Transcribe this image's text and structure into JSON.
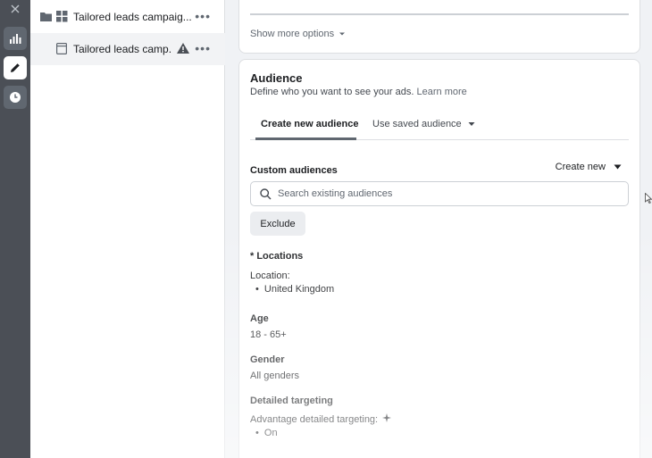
{
  "rail": {
    "icons": [
      "close-icon",
      "bar-chart-icon",
      "pencil-icon",
      "clock-icon"
    ]
  },
  "tree": {
    "campaign": {
      "label": "Tailored leads campaig...",
      "more": "•••"
    },
    "ad": {
      "label": "Tailored leads camp...",
      "more": "•••"
    }
  },
  "section_above": {
    "show_more_label": "Show more options"
  },
  "audience": {
    "title": "Audience",
    "description": "Define who you want to see your ads.",
    "learn_more": "Learn more",
    "tabs": [
      {
        "label": "Create new audience"
      },
      {
        "label": "Use saved audience"
      }
    ],
    "custom_audiences_label": "Custom audiences",
    "create_new_label": "Create new",
    "search_placeholder": "Search existing audiences",
    "exclude_label": "Exclude",
    "locations": {
      "heading": "* Locations",
      "sub": "Location:",
      "value": "United Kingdom"
    },
    "age": {
      "heading": "Age",
      "value": "18 - 65+"
    },
    "gender": {
      "heading": "Gender",
      "value": "All genders"
    },
    "detailed": {
      "heading": "Detailed targeting",
      "advantage_label": "Advantage detailed targeting:",
      "value": "On"
    }
  },
  "colors": {
    "rail": "#4b4f56",
    "card": "#ffffff",
    "background": "#f0f2f5"
  }
}
